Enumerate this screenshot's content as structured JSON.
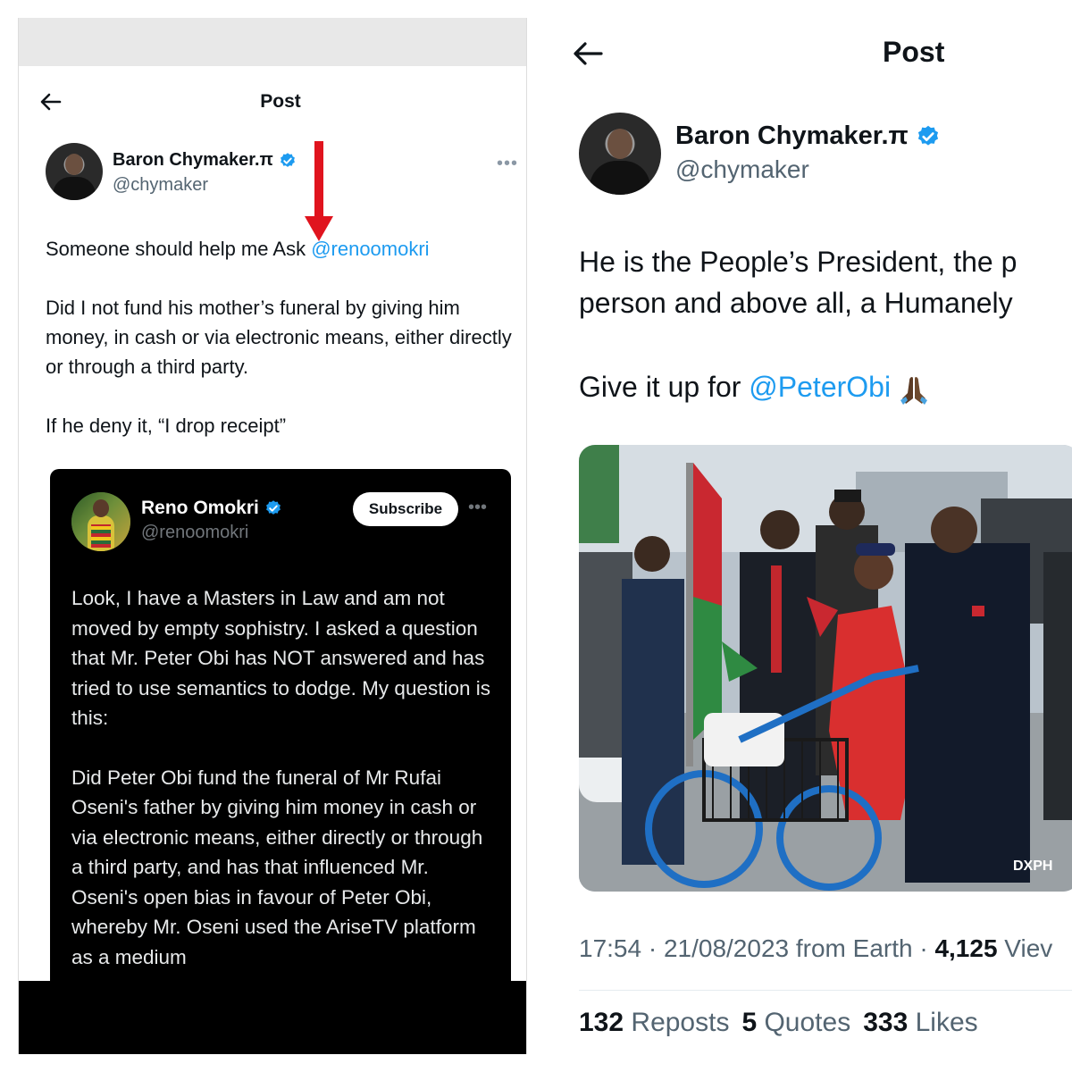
{
  "left_post": {
    "header_title": "Post",
    "author": {
      "name": "Baron Chymaker.π",
      "handle": "@chymaker"
    },
    "text": {
      "line1_prefix": "Someone should help me Ask ",
      "line1_mention": "@renoomokri",
      "para2": "Did I not fund his mother’s funeral by giving him money,  in cash or via electronic means, either directly or through a third party.",
      "para3": "If he deny it, “I drop receipt”"
    },
    "quote": {
      "name": "Reno Omokri",
      "handle": "@renoomokri",
      "subscribe_label": "Subscribe",
      "para1": "Look, I have a Masters in Law and am not moved by empty sophistry. I asked a question that Mr. Peter Obi has NOT answered and has tried to use semantics to dodge. My question is this:",
      "para2": "Did Peter Obi fund the funeral of Mr Rufai Oseni's father by giving him money in cash or via electronic means, either directly or through a third party, and has that influenced Mr. Oseni's open bias in favour of Peter Obi, whereby Mr. Oseni used the AriseTV platform as a medium"
    }
  },
  "right_post": {
    "header_title": "Post",
    "author": {
      "name": "Baron Chymaker.π",
      "handle": "@chymaker"
    },
    "text": {
      "line1": "He is the People’s President, the p",
      "line2": "person and above all, a Humanely",
      "line3_prefix": "Give it up for ",
      "line3_mention": "@PeterObi"
    },
    "photo_watermark": "DXPH",
    "meta": {
      "time_date": "17:54 · 21/08/2023 from Earth · ",
      "views_count": "4,125",
      "views_label": " Viev"
    },
    "stats": {
      "reposts_count": "132",
      "reposts_label": " Reposts",
      "quotes_count": "5",
      "quotes_label": " Quotes",
      "likes_count": "333",
      "likes_label": " Likes"
    }
  },
  "colors": {
    "link": "#1d9bf0",
    "verified": "#1d9bf0",
    "arrow": "#e0141e"
  }
}
